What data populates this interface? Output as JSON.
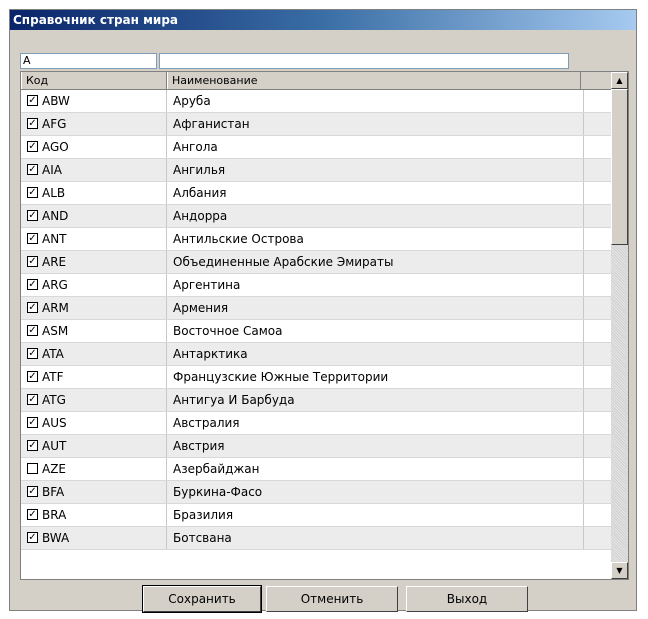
{
  "window": {
    "title": "Справочник стран мира"
  },
  "filters": {
    "code_value": "A",
    "name_value": ""
  },
  "grid": {
    "columns": [
      "Код",
      "Наименование"
    ],
    "rows": [
      {
        "checked": true,
        "code": "ABW",
        "name": "Аруба"
      },
      {
        "checked": true,
        "code": "AFG",
        "name": "Афганистан"
      },
      {
        "checked": true,
        "code": "AGO",
        "name": "Ангола"
      },
      {
        "checked": true,
        "code": "AIA",
        "name": "Ангилья"
      },
      {
        "checked": true,
        "code": "ALB",
        "name": "Албания"
      },
      {
        "checked": true,
        "code": "AND",
        "name": "Андорра"
      },
      {
        "checked": true,
        "code": "ANT",
        "name": "Антильские Острова"
      },
      {
        "checked": true,
        "code": "ARE",
        "name": "Объединенные Арабские Эмираты"
      },
      {
        "checked": true,
        "code": "ARG",
        "name": "Аргентина"
      },
      {
        "checked": true,
        "code": "ARM",
        "name": "Армения"
      },
      {
        "checked": true,
        "code": "ASM",
        "name": "Восточное Самоа"
      },
      {
        "checked": true,
        "code": "ATA",
        "name": "Антарктика"
      },
      {
        "checked": true,
        "code": "ATF",
        "name": "Французские Южные Территории"
      },
      {
        "checked": true,
        "code": "ATG",
        "name": "Антигуа И Барбуда"
      },
      {
        "checked": true,
        "code": "AUS",
        "name": "Австралия"
      },
      {
        "checked": true,
        "code": "AUT",
        "name": "Австрия"
      },
      {
        "checked": false,
        "code": "AZE",
        "name": "Азербайджан"
      },
      {
        "checked": true,
        "code": "BFA",
        "name": "Буркина-Фасо"
      },
      {
        "checked": true,
        "code": "BRA",
        "name": "Бразилия"
      },
      {
        "checked": true,
        "code": "BWA",
        "name": "Ботсвана"
      }
    ]
  },
  "buttons": {
    "save": "Сохранить",
    "cancel": "Отменить",
    "exit": "Выход"
  },
  "icons": {
    "check": "checkmark-icon",
    "up": "arrow-up-icon",
    "down": "arrow-down-icon"
  }
}
